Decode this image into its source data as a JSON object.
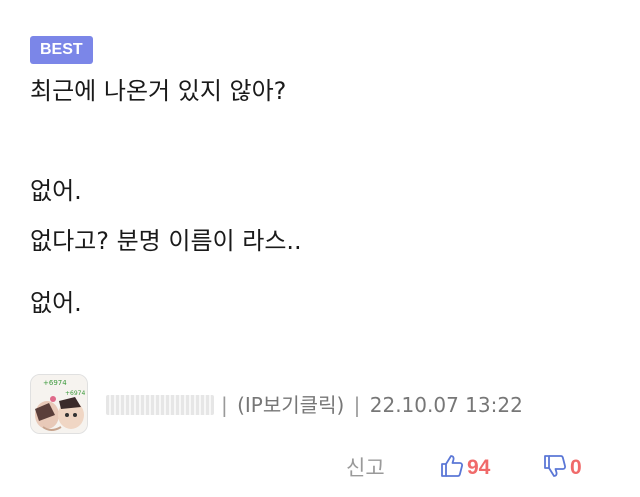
{
  "badge": {
    "label": "BEST"
  },
  "comment": {
    "lines": [
      "최근에 나온거 있지 않아?",
      "없어.",
      "없다고? 분명 이름이 라스..",
      "없어."
    ]
  },
  "author": {
    "nickname_hidden": true,
    "ip_link": "(IP보기클릭)",
    "separator": "|",
    "timestamp": "22.10.07 13:22",
    "avatar_caption_1": "+6974",
    "avatar_caption_2": "+6974"
  },
  "actions": {
    "report_label": "신고",
    "like_count": "94",
    "dislike_count": "0"
  },
  "colors": {
    "badge": "#7b86e8",
    "vote": "#f06a6a",
    "icon": "#5b77d6",
    "muted": "#777777"
  },
  "icons": [
    "thumbs-up-icon",
    "thumbs-down-icon"
  ]
}
